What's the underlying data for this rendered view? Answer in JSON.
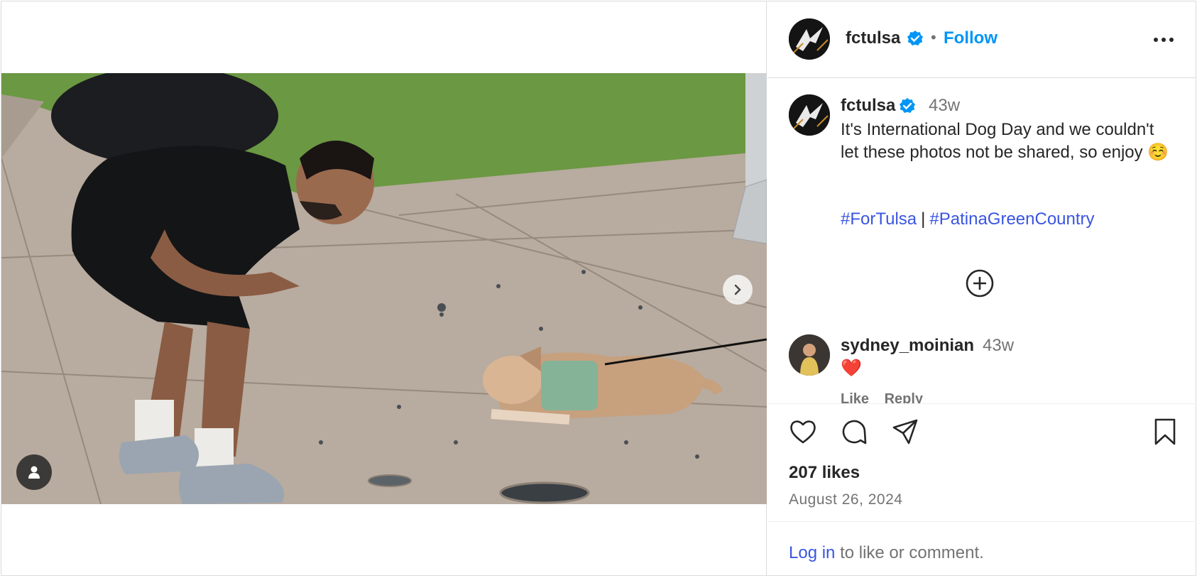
{
  "post": {
    "author": "fctulsa",
    "follow_label": "Follow",
    "separator": "•",
    "more_icon": "more-horizontal-icon"
  },
  "caption": {
    "user": "fctulsa",
    "time": "43w",
    "text": "It's International Dog Day and we couldn't let these photos not be shared, so enjoy ☺️",
    "hashtag_1": "#ForTulsa",
    "hashtag_sep": "|",
    "hashtag_2": "#PatinaGreenCountry"
  },
  "comment": {
    "user": "sydney_moinian",
    "time": "43w",
    "text": "❤️",
    "like_label": "Like",
    "reply_label": "Reply"
  },
  "stats": {
    "likes": "207 likes",
    "date": "August 26, 2024"
  },
  "login": {
    "link": "Log in",
    "rest": "to like or comment."
  },
  "colors": {
    "accent": "#0095f6",
    "link": "#3a55e0",
    "text": "#262626",
    "muted": "#737373"
  }
}
